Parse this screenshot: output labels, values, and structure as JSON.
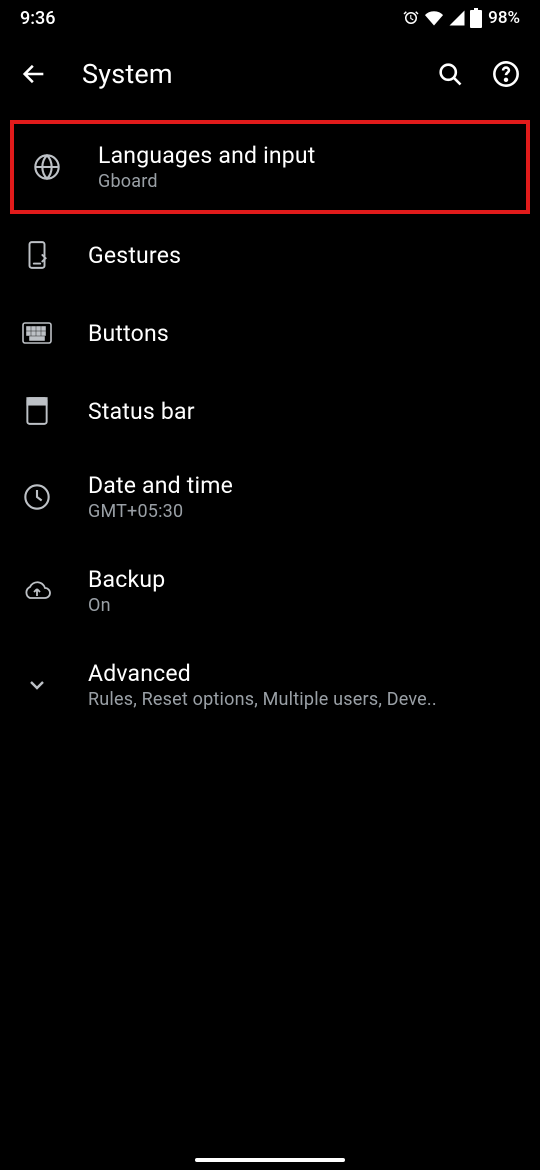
{
  "status": {
    "time": "9:36",
    "battery": "98%"
  },
  "appbar": {
    "title": "System"
  },
  "items": [
    {
      "title": "Languages and input",
      "subtitle": "Gboard"
    },
    {
      "title": "Gestures",
      "subtitle": ""
    },
    {
      "title": "Buttons",
      "subtitle": ""
    },
    {
      "title": "Status bar",
      "subtitle": ""
    },
    {
      "title": "Date and time",
      "subtitle": "GMT+05:30"
    },
    {
      "title": "Backup",
      "subtitle": "On"
    },
    {
      "title": "Advanced",
      "subtitle": "Rules, Reset options, Multiple users, Deve.."
    }
  ]
}
